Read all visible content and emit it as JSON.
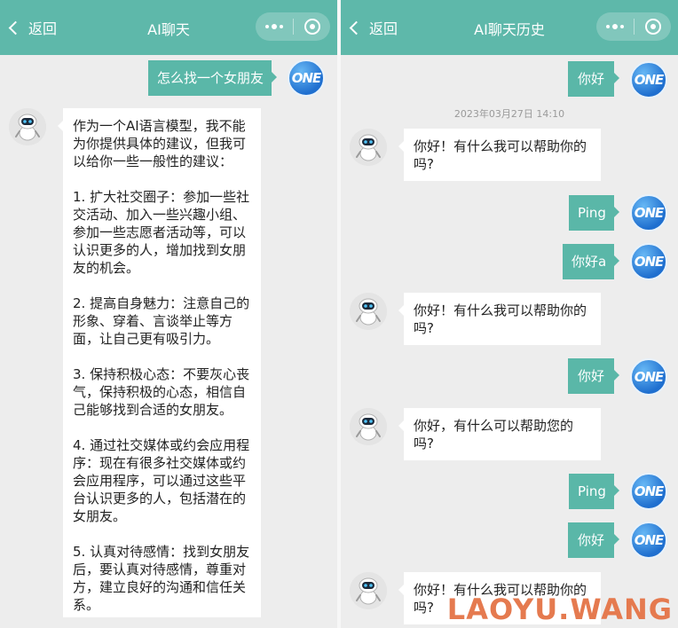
{
  "left": {
    "header": {
      "back_label": "返回",
      "title": "AI聊天"
    },
    "user_message": "怎么找一个女朋友",
    "bot_message": "作为一个AI语言模型，我不能\n为你提供具体的建议，但我可\n以给你一些一般性的建议：\n\n1. 扩大社交圈子：参加一些社\n交活动、加入一些兴趣小组、\n参加一些志愿者活动等，可以\n认识更多的人，增加找到女朋\n友的机会。\n\n2. 提高自身魅力：注意自己的\n形象、穿着、言谈举止等方\n面，让自己更有吸引力。\n\n3. 保持积极心态：不要灰心丧\n气，保持积极的心态，相信自\n己能够找到合适的女朋友。\n\n4. 通过社交媒体或约会应用程\n序：现在有很多社交媒体或约\n会应用程序，可以通过这些平\n台认识更多的人，包括潜在的\n女朋友。\n\n5. 认真对待感情：找到女朋友\n后，要认真对待感情，尊重对\n方，建立良好的沟通和信任关\n系。"
  },
  "right": {
    "header": {
      "back_label": "返回",
      "title": "AI聊天历史"
    },
    "timestamp": "2023年03月27日 14:10",
    "messages": [
      {
        "role": "user",
        "text": "你好"
      },
      {
        "role": "bot",
        "text": "你好！有什么我可以帮助你的\n吗?"
      },
      {
        "role": "user",
        "text": "Ping"
      },
      {
        "role": "user",
        "text": "你好a"
      },
      {
        "role": "bot",
        "text": "你好！有什么我可以帮助你的\n吗?"
      },
      {
        "role": "user",
        "text": "你好"
      },
      {
        "role": "bot",
        "text": "你好，有什么可以帮助您的\n吗?"
      },
      {
        "role": "user",
        "text": "Ping"
      },
      {
        "role": "user",
        "text": "你好"
      },
      {
        "role": "bot",
        "text": "你好！有什么我可以帮助你的\n吗?"
      }
    ]
  },
  "avatar_text": "ONE",
  "watermark": "LAOYU.WANG",
  "colors": {
    "header": "#5eb8aa",
    "user_bubble": "#5ab7a8",
    "background": "#ededed",
    "watermark": "#e57a4f"
  }
}
